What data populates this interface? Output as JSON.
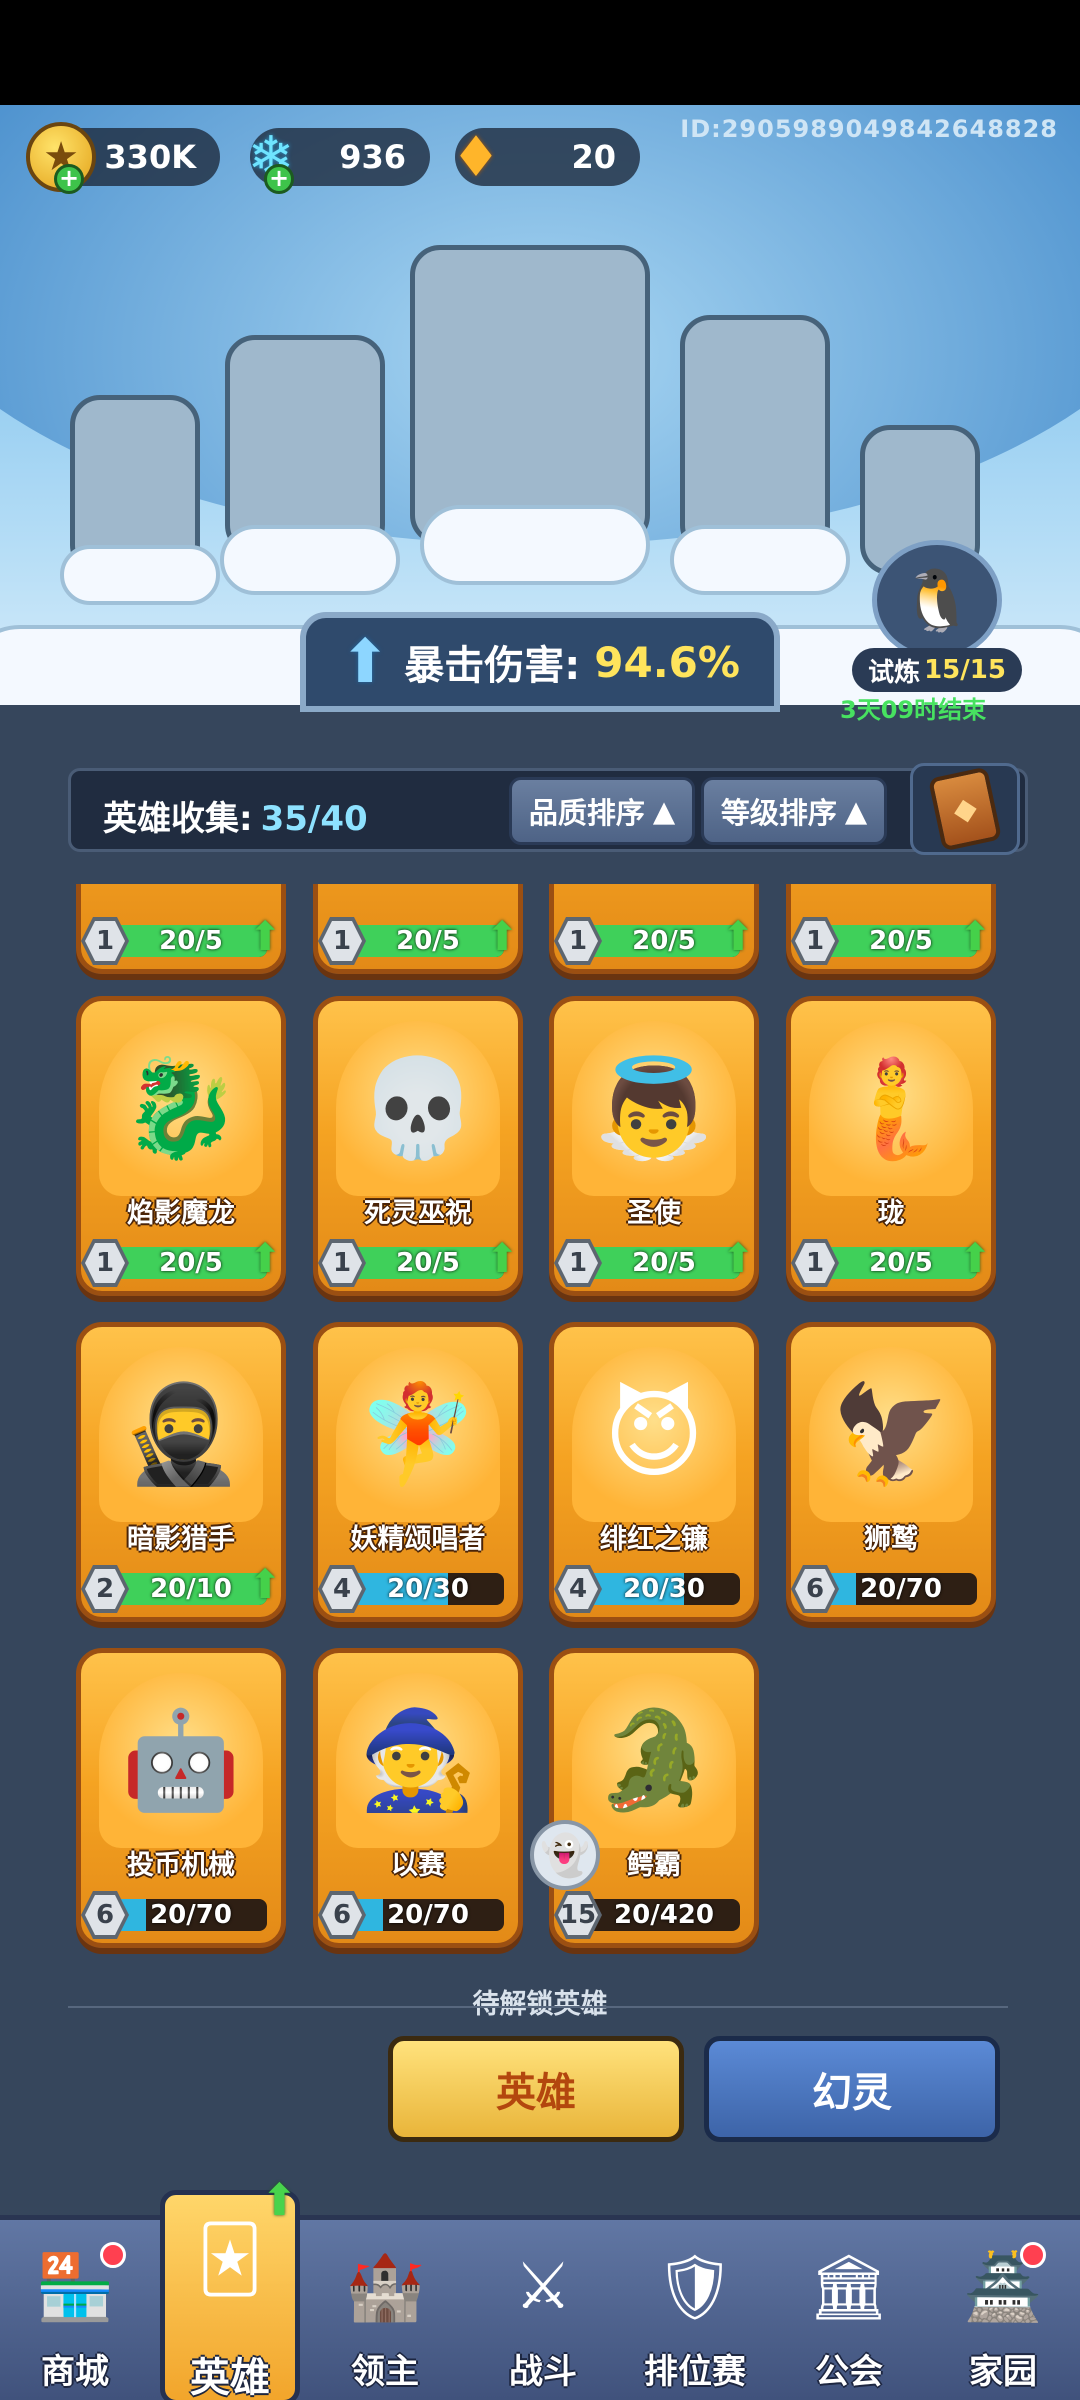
{
  "header": {
    "uid": "ID:2905989049842648828"
  },
  "resources": [
    {
      "name": "gold",
      "value": "330K",
      "icon": "coin-icon"
    },
    {
      "name": "diamond",
      "value": "936",
      "icon": "gem-icon"
    },
    {
      "name": "crystal",
      "value": "20",
      "icon": "crystal-icon"
    }
  ],
  "bonus": {
    "label": "暴击伤害:",
    "value": "94.6%"
  },
  "trial": {
    "label": "试炼",
    "count": "15/15",
    "timer": "3天09时结束"
  },
  "collection": {
    "label": "英雄收集:",
    "count": "35/40",
    "sort_quality": "品质排序",
    "sort_level": "等级排序",
    "sort_arrow": "▲"
  },
  "heroes": [
    {
      "name": "",
      "level": "1",
      "progress": "20/5",
      "fill": 1,
      "bar": "green",
      "upgrade": true
    },
    {
      "name": "",
      "level": "1",
      "progress": "20/5",
      "fill": 1,
      "bar": "green",
      "upgrade": true
    },
    {
      "name": "",
      "level": "1",
      "progress": "20/5",
      "fill": 1,
      "bar": "green",
      "upgrade": true
    },
    {
      "name": "",
      "level": "1",
      "progress": "20/5",
      "fill": 1,
      "bar": "green",
      "upgrade": true
    },
    {
      "name": "焰影魔龙",
      "level": "1",
      "progress": "20/5",
      "fill": 1,
      "bar": "green",
      "upgrade": true,
      "art": "🐉"
    },
    {
      "name": "死灵巫祝",
      "level": "1",
      "progress": "20/5",
      "fill": 1,
      "bar": "green",
      "upgrade": true,
      "art": "💀"
    },
    {
      "name": "圣使",
      "level": "1",
      "progress": "20/5",
      "fill": 1,
      "bar": "green",
      "upgrade": true,
      "art": "👼"
    },
    {
      "name": "珑",
      "level": "1",
      "progress": "20/5",
      "fill": 1,
      "bar": "green",
      "upgrade": true,
      "art": "🧜"
    },
    {
      "name": "暗影猎手",
      "level": "2",
      "progress": "20/10",
      "fill": 1,
      "bar": "green",
      "upgrade": true,
      "art": "🥷"
    },
    {
      "name": "妖精颂唱者",
      "level": "4",
      "progress": "20/30",
      "fill": 0.67,
      "bar": "blue",
      "upgrade": false,
      "art": "🧚"
    },
    {
      "name": "绯红之镰",
      "level": "4",
      "progress": "20/30",
      "fill": 0.67,
      "bar": "blue",
      "upgrade": false,
      "art": "😈"
    },
    {
      "name": "狮鹫",
      "level": "6",
      "progress": "20/70",
      "fill": 0.29,
      "bar": "blue",
      "upgrade": false,
      "art": "🦅"
    },
    {
      "name": "投币机械",
      "level": "6",
      "progress": "20/70",
      "fill": 0.29,
      "bar": "blue",
      "upgrade": false,
      "art": "🤖"
    },
    {
      "name": "以赛",
      "level": "6",
      "progress": "20/70",
      "fill": 0.29,
      "bar": "blue",
      "upgrade": false,
      "art": "🧙"
    },
    {
      "name": "鳄霸",
      "level": "15",
      "progress": "20/420",
      "fill": 0.05,
      "bar": "blue",
      "upgrade": false,
      "art": "🐊"
    }
  ],
  "locked_section": {
    "label": "待解锁英雄"
  },
  "tabs": {
    "hero": "英雄",
    "phantom": "幻灵"
  },
  "nav": [
    {
      "label": "商城",
      "icon": "shop-icon"
    },
    {
      "label": "英雄",
      "icon": "hero-card-icon"
    },
    {
      "label": "领主",
      "icon": "lord-banner-icon"
    },
    {
      "label": "战斗",
      "icon": "battle-swords-icon"
    },
    {
      "label": "排位赛",
      "icon": "ranked-shield-icon"
    },
    {
      "label": "公会",
      "icon": "guild-castle-icon"
    },
    {
      "label": "家园",
      "icon": "home-castle-icon"
    }
  ],
  "colors": {
    "gold": "#ffe45c",
    "green_bar": "#3fd05a",
    "blue_bar": "#2fb6e0",
    "panel": "#36465c"
  }
}
